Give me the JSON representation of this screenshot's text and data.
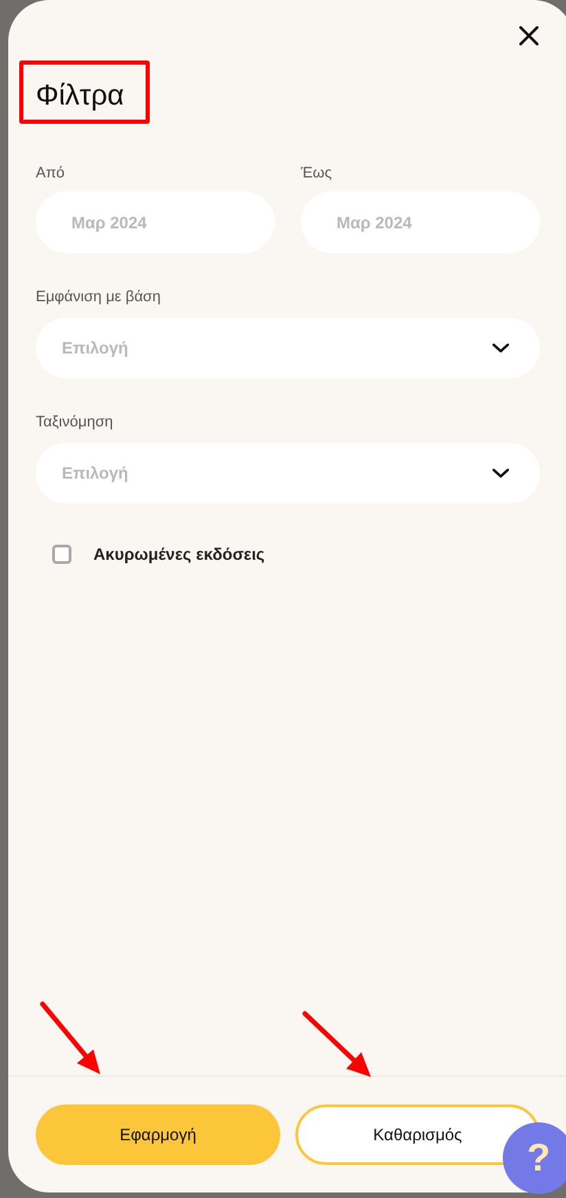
{
  "title": "Φίλτρα",
  "date_fields": [
    {
      "label": "Από",
      "placeholder": "Μαρ 2024"
    },
    {
      "label": "Έως",
      "placeholder": "Μαρ 2024"
    }
  ],
  "selects": [
    {
      "label": "Εμφάνιση με βάση",
      "placeholder": "Επιλογή"
    },
    {
      "label": "Ταξινόμηση",
      "placeholder": "Επιλογή"
    }
  ],
  "checkbox": {
    "label": "Ακυρωμένες εκδόσεις",
    "checked": false
  },
  "buttons": [
    {
      "label": "Εφαρμογή",
      "kind": "primary"
    },
    {
      "label": "Καθαρισμός",
      "kind": "outline"
    }
  ],
  "help_button": "?"
}
